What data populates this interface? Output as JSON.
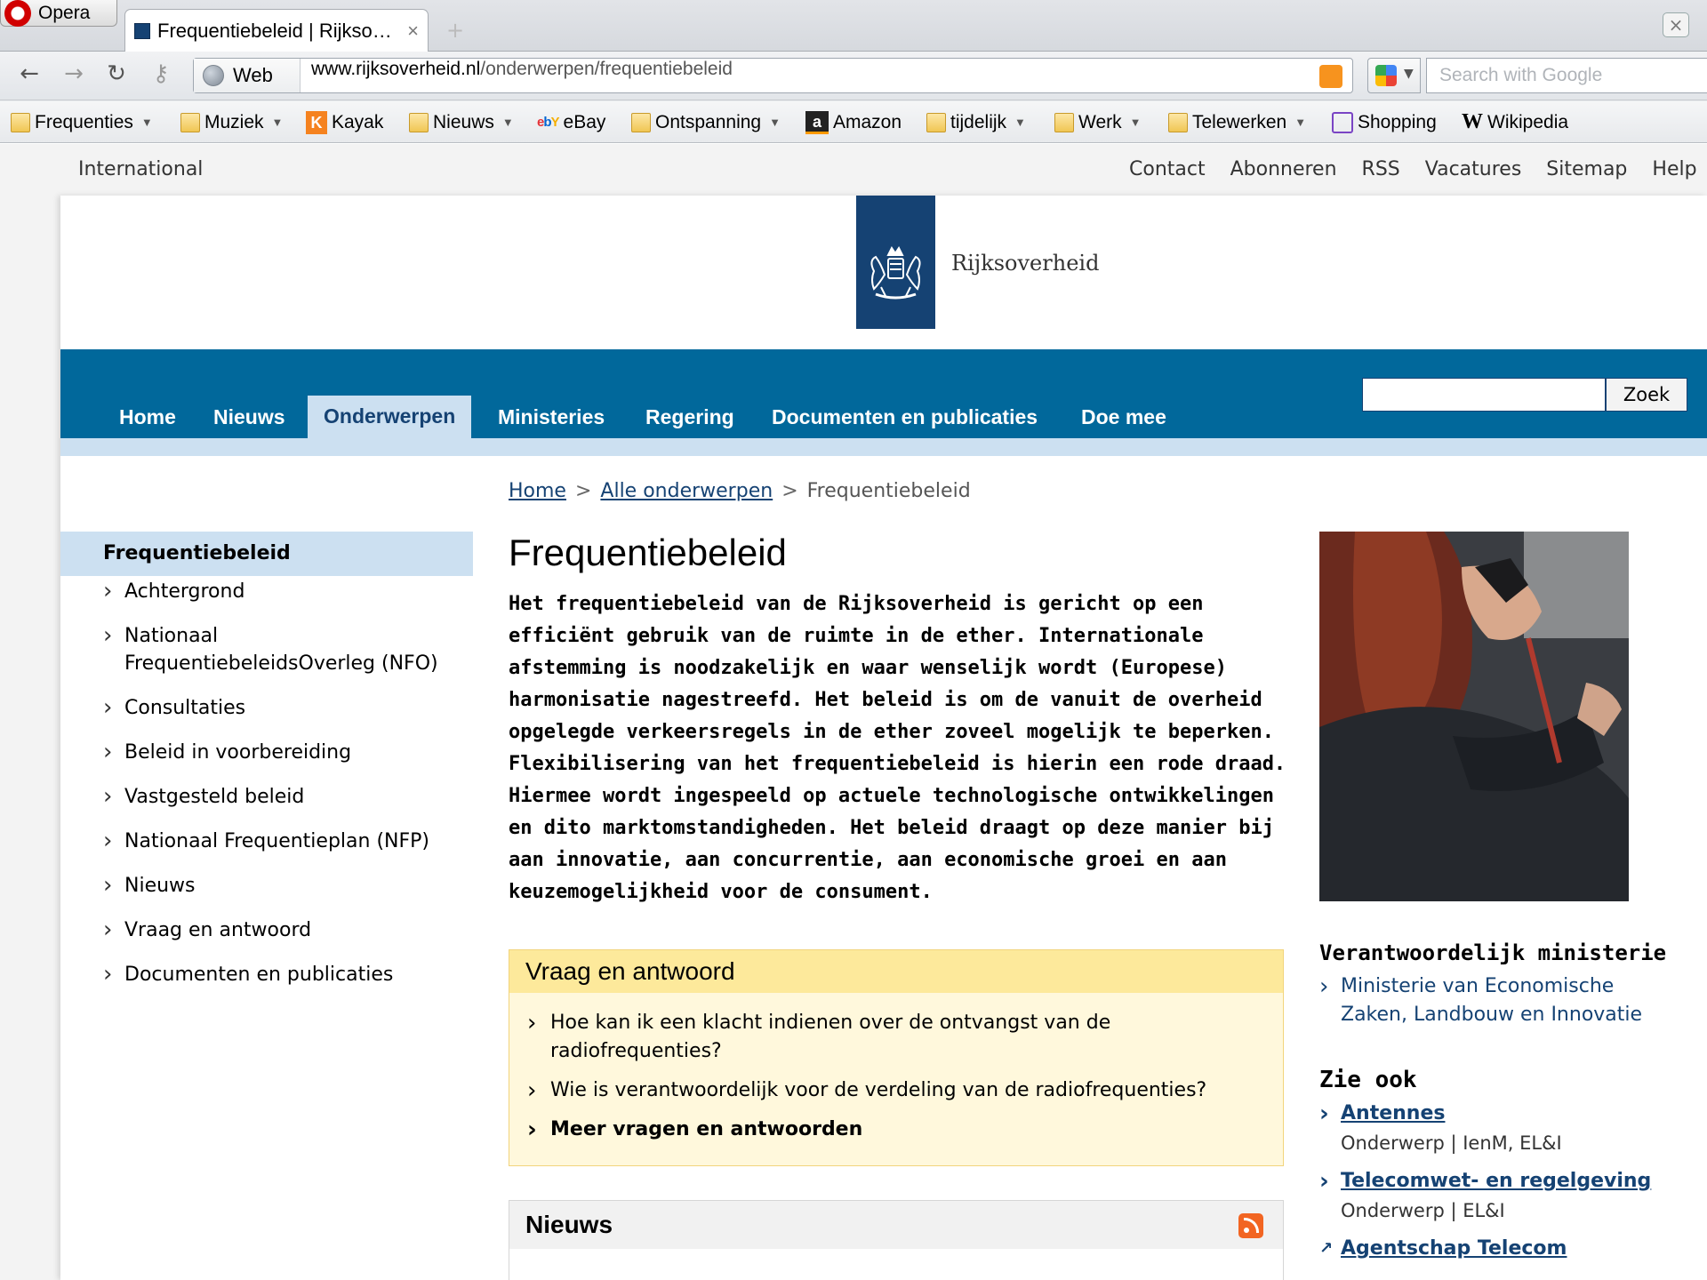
{
  "browser": {
    "app_name": "Opera",
    "tab_title": "Frequentiebeleid | Rijkso…",
    "tab_close": "×",
    "address_prefix": "Web",
    "url_host": "www.rijksoverheid.nl",
    "url_path": "/onderwerpen/frequentiebeleid",
    "search_placeholder": "Search with Google",
    "bookmarks": [
      {
        "label": "Frequenties",
        "icon": "folder-icon",
        "dropdown": true
      },
      {
        "label": "Muziek",
        "icon": "folder-icon",
        "dropdown": true
      },
      {
        "label": "Kayak",
        "icon": "kayak-icon",
        "dropdown": false
      },
      {
        "label": "Nieuws",
        "icon": "folder-icon",
        "dropdown": true
      },
      {
        "label": "eBay",
        "icon": "ebay-icon",
        "dropdown": false
      },
      {
        "label": "Ontspanning",
        "icon": "folder-icon",
        "dropdown": true
      },
      {
        "label": "Amazon",
        "icon": "amazon-icon",
        "dropdown": false
      },
      {
        "label": "tijdelijk",
        "icon": "folder-icon",
        "dropdown": true
      },
      {
        "label": "Werk",
        "icon": "folder-icon",
        "dropdown": true
      },
      {
        "label": "Telewerken",
        "icon": "folder-icon",
        "dropdown": true
      },
      {
        "label": "Shopping",
        "icon": "shopping-icon",
        "dropdown": false
      },
      {
        "label": "Wikipedia",
        "icon": "wikipedia-icon",
        "dropdown": false
      }
    ]
  },
  "site": {
    "util_left": "International",
    "util_links": [
      "Contact",
      "Abonneren",
      "RSS",
      "Vacatures",
      "Sitemap",
      "Help"
    ],
    "logo_text": "Rijksoverheid",
    "nav": [
      {
        "label": "Home",
        "active": false
      },
      {
        "label": "Nieuws",
        "active": false
      },
      {
        "label": "Onderwerpen",
        "active": true
      },
      {
        "label": "Ministeries",
        "active": false
      },
      {
        "label": "Regering",
        "active": false
      },
      {
        "label": "Documenten en publicaties",
        "active": false
      },
      {
        "label": "Doe mee",
        "active": false
      }
    ],
    "search_button": "Zoek",
    "colors": {
      "brand_dark": "#154273",
      "nav_blue": "#01689b",
      "nav_light": "#cce0f1",
      "qa_bg": "#fff8dc",
      "qa_head": "#fde99b"
    }
  },
  "breadcrumb": {
    "home": "Home",
    "all_topics": "Alle onderwerpen",
    "current": "Frequentiebeleid",
    "separator": ">"
  },
  "sidenav": {
    "title": "Frequentiebeleid",
    "items": [
      "Achtergrond",
      "Nationaal FrequentiebeleidsOverleg (NFO)",
      "Consultaties",
      "Beleid in voorbereiding",
      "Vastgesteld beleid",
      "Nationaal Frequentieplan (NFP)",
      "Nieuws",
      "Vraag en antwoord",
      "Documenten en publicaties"
    ]
  },
  "main": {
    "title": "Frequentiebeleid",
    "intro": "Het frequentiebeleid van de Rijksoverheid is gericht op een efficiënt gebruik van de ruimte in de ether. Internationale afstemming is noodzakelijk en waar wenselijk wordt (Europese) harmonisatie nagestreefd. Het beleid is om de vanuit de overheid opgelegde verkeersregels in de ether zoveel mogelijk te beperken. Flexibilisering van het frequentiebeleid is hierin een rode draad. Hiermee wordt ingespeeld op actuele technologische ontwikkelingen en dito marktomstandigheden. Het beleid draagt op deze manier bij aan innovatie, aan concurrentie, aan economische groei en aan keuzemogelijkheid voor de consument.",
    "qa": {
      "title": "Vraag en antwoord",
      "items": [
        "Hoe kan ik een klacht indienen over de ontvangst van de radiofrequenties?",
        "Wie is verantwoordelijk voor de verdeling van de radiofrequenties?"
      ],
      "more": "Meer vragen en antwoorden"
    },
    "news": {
      "title": "Nieuws"
    }
  },
  "right": {
    "ministry_heading": "Verantwoordelijk ministerie",
    "ministry_link": "Ministerie van Economische Zaken, Landbouw en Innovatie",
    "see_also_heading": "Zie ook",
    "see_also": [
      {
        "label": "Antennes",
        "meta": "Onderwerp | IenM, EL&I"
      },
      {
        "label": "Telecomwet- en regelgeving",
        "meta": "Onderwerp | EL&I"
      },
      {
        "label": "Agentschap Telecom",
        "meta": ""
      }
    ]
  }
}
